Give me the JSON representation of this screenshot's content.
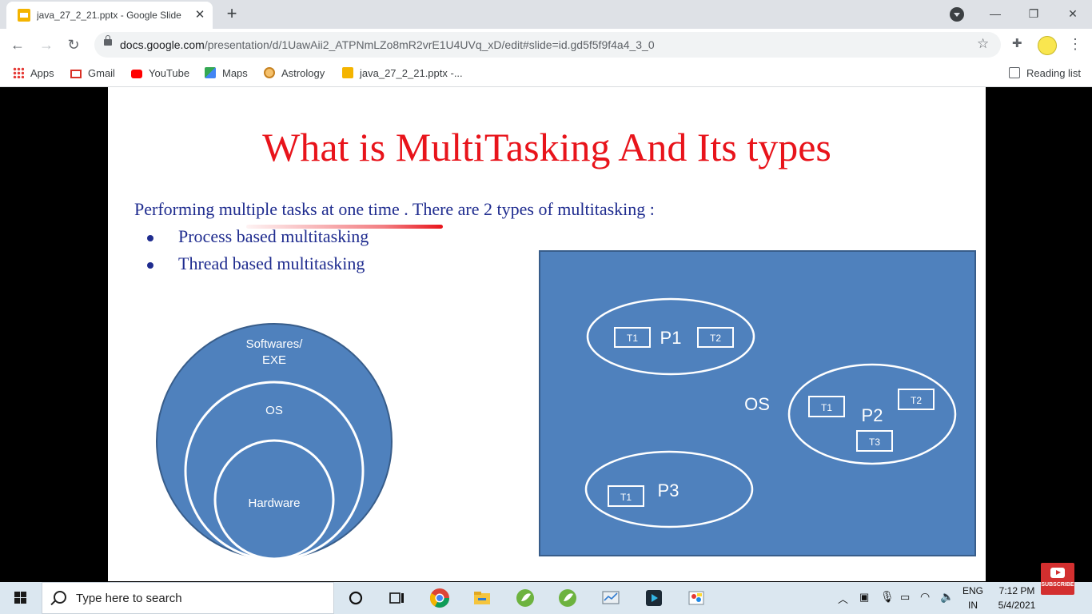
{
  "browser": {
    "tab_title": "java_27_2_21.pptx - Google Slide",
    "url_host": "docs.google.com",
    "url_path": "/presentation/d/1UawAii2_ATPNmLZo8mR2vrE1U4UVq_xD/edit#slide=id.gd5f5f9f4a4_3_0",
    "bookmarks": [
      {
        "label": "Apps",
        "icon": "apps-grid-icon"
      },
      {
        "label": "Gmail",
        "icon": "gmail-icon"
      },
      {
        "label": "YouTube",
        "icon": "youtube-icon"
      },
      {
        "label": "Maps",
        "icon": "maps-icon"
      },
      {
        "label": "Astrology",
        "icon": "astrology-icon"
      },
      {
        "label": "java_27_2_21.pptx -...",
        "icon": "slides-icon"
      }
    ],
    "reading_list": "Reading list"
  },
  "slide": {
    "title": "What is MultiTasking And Its types",
    "intro": "Performing  multiple tasks at one time . There are 2 types of multitasking :",
    "bullets": [
      "Process based multitasking",
      "Thread based multitasking"
    ],
    "layers": {
      "outer": "Softwares/",
      "outer2": "EXE",
      "middle": "OS",
      "inner": "Hardware"
    },
    "os_box": {
      "label": "OS",
      "processes": [
        {
          "name": "P1",
          "threads": [
            "T1",
            "T2"
          ]
        },
        {
          "name": "P2",
          "threads": [
            "T1",
            "T2",
            "T3"
          ]
        },
        {
          "name": "P3",
          "threads": [
            "T1"
          ]
        }
      ]
    },
    "colors": {
      "title": "#e8141b",
      "text": "#1f2c8f",
      "diagram_fill": "#4f81bd",
      "diagram_stroke": "#385d8a"
    }
  },
  "taskbar": {
    "search_placeholder": "Type here to search",
    "lang_1": "ENG",
    "lang_2": "IN",
    "time": "7:12 PM",
    "date": "5/4/2021"
  },
  "overlay": {
    "subscribe": "SUBSCRIBE"
  }
}
